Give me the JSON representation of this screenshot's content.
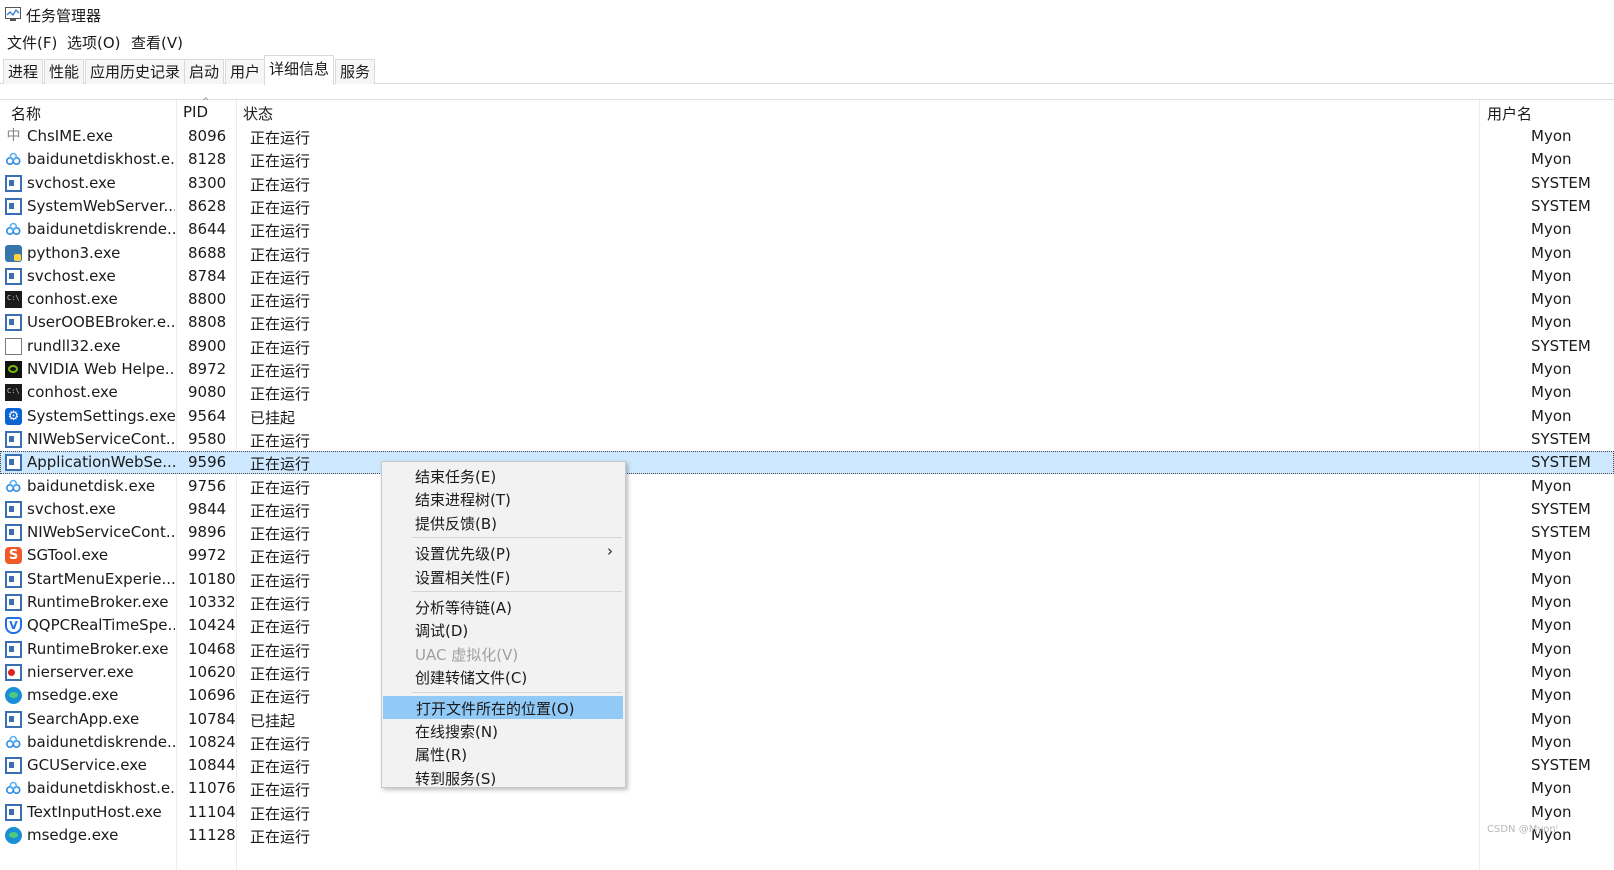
{
  "window": {
    "title": "任务管理器"
  },
  "menubar": {
    "items": [
      "文件(F)",
      "选项(O)",
      "查看(V)"
    ]
  },
  "tabs": [
    "进程",
    "性能",
    "应用历史记录",
    "启动",
    "用户",
    "详细信息",
    "服务"
  ],
  "active_tab": "详细信息",
  "columns": {
    "name": "名称",
    "pid": "PID",
    "status": "状态",
    "user": "用户名"
  },
  "rows": [
    {
      "icon": "ime-icon",
      "name": "ChsIME.exe",
      "pid": "8096",
      "status": "正在运行",
      "user": "Myon"
    },
    {
      "icon": "baidu-cloud-icon",
      "name": "baidunetdiskhost.e...",
      "pid": "8128",
      "status": "正在运行",
      "user": "Myon"
    },
    {
      "icon": "window-icon",
      "name": "svchost.exe",
      "pid": "8300",
      "status": "正在运行",
      "user": "SYSTEM"
    },
    {
      "icon": "window-icon",
      "name": "SystemWebServer....",
      "pid": "8628",
      "status": "正在运行",
      "user": "SYSTEM"
    },
    {
      "icon": "baidu-cloud-icon",
      "name": "baidunetdiskrende...",
      "pid": "8644",
      "status": "正在运行",
      "user": "Myon"
    },
    {
      "icon": "python-icon",
      "name": "python3.exe",
      "pid": "8688",
      "status": "正在运行",
      "user": "Myon"
    },
    {
      "icon": "window-icon",
      "name": "svchost.exe",
      "pid": "8784",
      "status": "正在运行",
      "user": "Myon"
    },
    {
      "icon": "console-icon",
      "name": "conhost.exe",
      "pid": "8800",
      "status": "正在运行",
      "user": "Myon"
    },
    {
      "icon": "window-icon",
      "name": "UserOOBEBroker.e...",
      "pid": "8808",
      "status": "正在运行",
      "user": "Myon"
    },
    {
      "icon": "file-icon",
      "name": "rundll32.exe",
      "pid": "8900",
      "status": "正在运行",
      "user": "SYSTEM"
    },
    {
      "icon": "nvidia-icon",
      "name": "NVIDIA Web Helpe...",
      "pid": "8972",
      "status": "正在运行",
      "user": "Myon"
    },
    {
      "icon": "console-icon",
      "name": "conhost.exe",
      "pid": "9080",
      "status": "正在运行",
      "user": "Myon"
    },
    {
      "icon": "gear-icon",
      "name": "SystemSettings.exe",
      "pid": "9564",
      "status": "已挂起",
      "user": "Myon"
    },
    {
      "icon": "window-icon",
      "name": "NIWebServiceCont...",
      "pid": "9580",
      "status": "正在运行",
      "user": "SYSTEM"
    },
    {
      "icon": "window-icon",
      "name": "ApplicationWebSe...",
      "pid": "9596",
      "status": "正在运行",
      "user": "SYSTEM",
      "selected": true
    },
    {
      "icon": "baidu-cloud-icon",
      "name": "baidunetdisk.exe",
      "pid": "9756",
      "status": "正在运行",
      "user": "Myon"
    },
    {
      "icon": "window-icon",
      "name": "svchost.exe",
      "pid": "9844",
      "status": "正在运行",
      "user": "SYSTEM"
    },
    {
      "icon": "window-icon",
      "name": "NIWebServiceCont...",
      "pid": "9896",
      "status": "正在运行",
      "user": "SYSTEM"
    },
    {
      "icon": "sogou-icon",
      "name": "SGTool.exe",
      "pid": "9972",
      "status": "正在运行",
      "user": "Myon"
    },
    {
      "icon": "window-icon",
      "name": "StartMenuExperie...",
      "pid": "10180",
      "status": "正在运行",
      "user": "Myon"
    },
    {
      "icon": "window-icon",
      "name": "RuntimeBroker.exe",
      "pid": "10332",
      "status": "正在运行",
      "user": "Myon"
    },
    {
      "icon": "shield-icon",
      "name": "QQPCRealTimeSpe...",
      "pid": "10424",
      "status": "正在运行",
      "user": "Myon"
    },
    {
      "icon": "window-icon",
      "name": "RuntimeBroker.exe",
      "pid": "10468",
      "status": "正在运行",
      "user": "Myon"
    },
    {
      "icon": "nier-icon",
      "name": "nierserver.exe",
      "pid": "10620",
      "status": "正在运行",
      "user": "Myon"
    },
    {
      "icon": "edge-icon",
      "name": "msedge.exe",
      "pid": "10696",
      "status": "正在运行",
      "user": "Myon"
    },
    {
      "icon": "window-icon",
      "name": "SearchApp.exe",
      "pid": "10784",
      "status": "已挂起",
      "user": "Myon"
    },
    {
      "icon": "baidu-cloud-icon",
      "name": "baidunetdiskrende...",
      "pid": "10824",
      "status": "正在运行",
      "user": "Myon"
    },
    {
      "icon": "window-icon",
      "name": "GCUService.exe",
      "pid": "10844",
      "status": "正在运行",
      "user": "SYSTEM"
    },
    {
      "icon": "baidu-cloud-icon",
      "name": "baidunetdiskhost.e...",
      "pid": "11076",
      "status": "正在运行",
      "user": "Myon"
    },
    {
      "icon": "window-icon",
      "name": "TextInputHost.exe",
      "pid": "11104",
      "status": "正在运行",
      "user": "Myon"
    },
    {
      "icon": "edge-icon",
      "name": "msedge.exe",
      "pid": "11128",
      "status": "正在运行",
      "user": "Myon"
    }
  ],
  "context_menu": {
    "groups": [
      [
        {
          "label": "结束任务(E)"
        },
        {
          "label": "结束进程树(T)"
        },
        {
          "label": "提供反馈(B)"
        }
      ],
      [
        {
          "label": "设置优先级(P)",
          "submenu": true
        },
        {
          "label": "设置相关性(F)"
        }
      ],
      [
        {
          "label": "分析等待链(A)"
        },
        {
          "label": "调试(D)"
        },
        {
          "label": "UAC 虚拟化(V)",
          "disabled": true
        },
        {
          "label": "创建转储文件(C)"
        }
      ],
      [
        {
          "label": "打开文件所在的位置(O)",
          "hover": true
        },
        {
          "label": "在线搜索(N)"
        },
        {
          "label": "属性(R)"
        },
        {
          "label": "转到服务(S)"
        }
      ]
    ]
  },
  "watermark": "CSDN @Myon⁽"
}
